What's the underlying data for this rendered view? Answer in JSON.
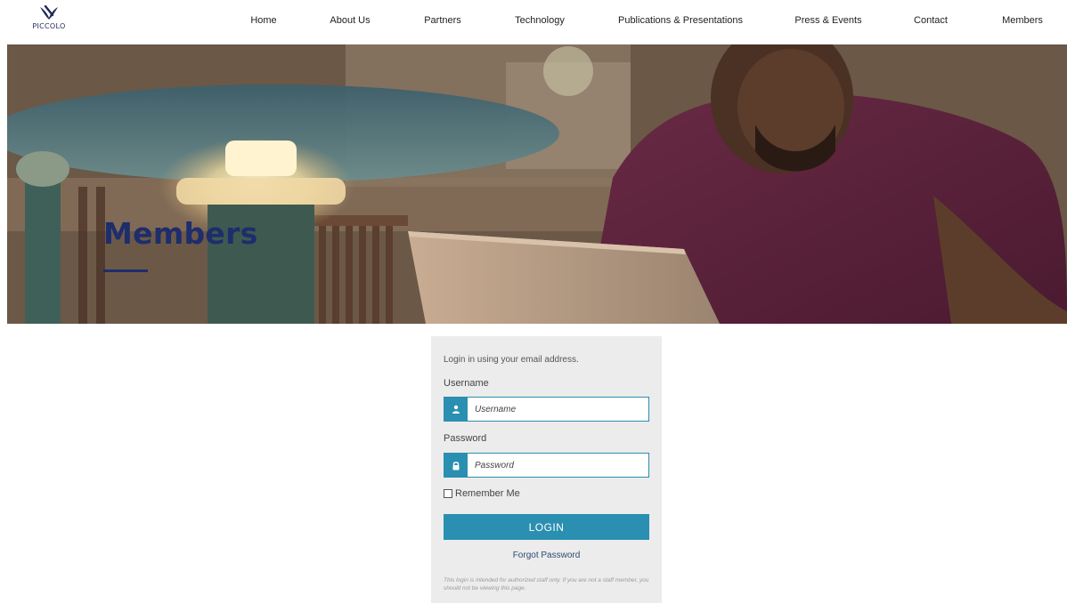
{
  "brand": {
    "logo_text": "PICCOLO",
    "color": "#1d2b55"
  },
  "nav": {
    "items": [
      {
        "label": "Home"
      },
      {
        "label": "About Us"
      },
      {
        "label": "Partners"
      },
      {
        "label": "Technology"
      },
      {
        "label": "Publications & Presentations"
      },
      {
        "label": "Press & Events"
      },
      {
        "label": "Contact"
      },
      {
        "label": "Members"
      }
    ]
  },
  "hero": {
    "title": "Members",
    "title_color": "#1e2d6b",
    "image": "person-with-laptop-in-library"
  },
  "login": {
    "intro": "Login in using your email address.",
    "username_label": "Username",
    "username_placeholder": "Username",
    "username_icon": "user-icon",
    "password_label": "Password",
    "password_placeholder": "Password",
    "password_icon": "lock-icon",
    "remember_label": "Remember Me",
    "remember_checked": false,
    "button_label": "LOGIN",
    "forgot_label": "Forgot Password",
    "notice": "This login is intended for authorized staff only. If you are not a staff member, you should not be viewing this page.",
    "accent_color": "#2a8fb0"
  }
}
